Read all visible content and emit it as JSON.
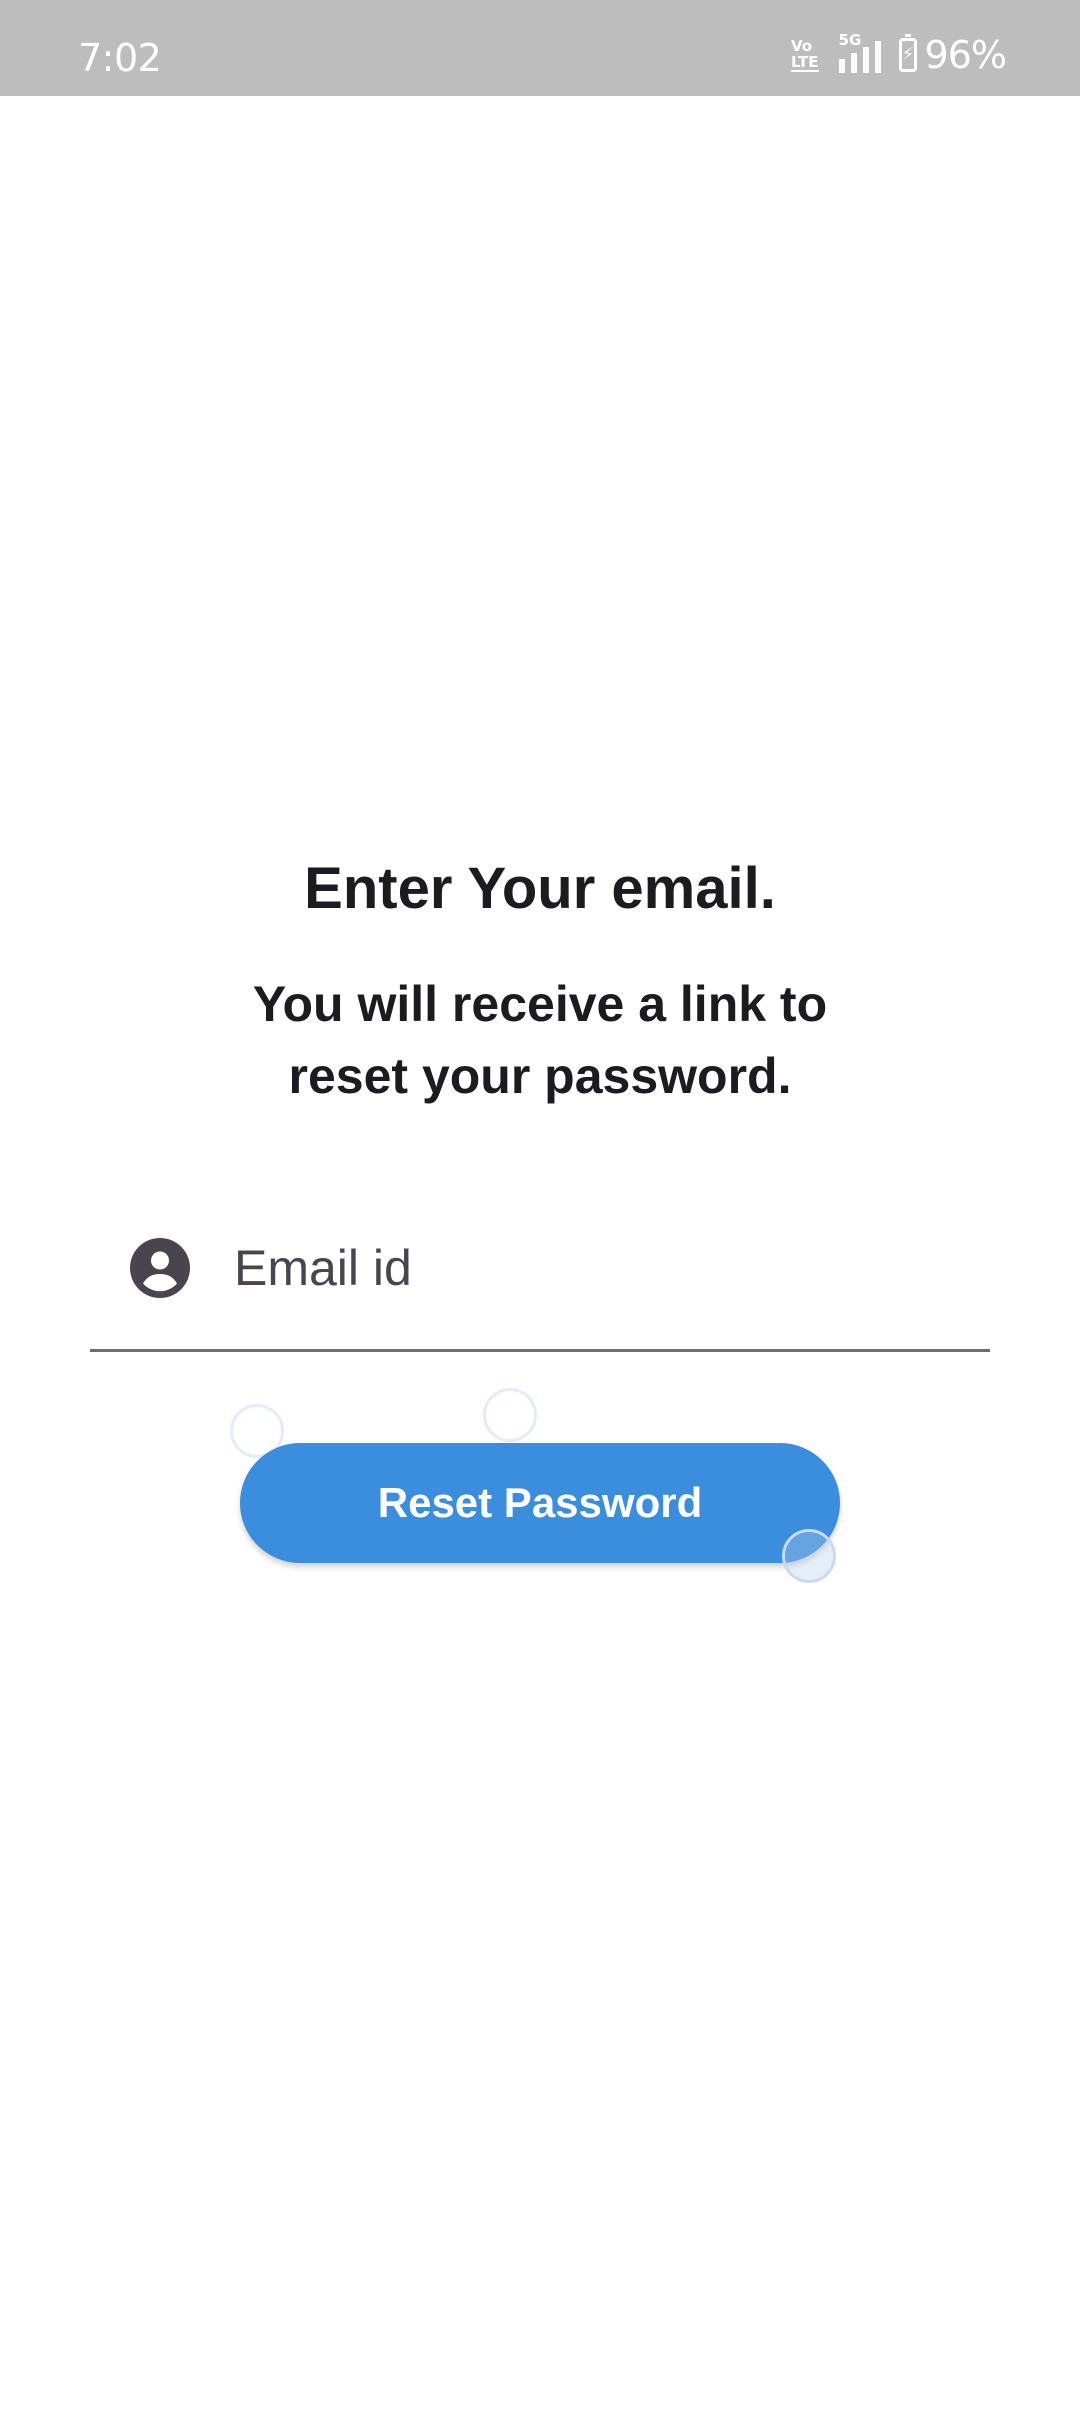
{
  "status_bar": {
    "time": "7:02",
    "volte_line1": "Vo",
    "volte_line2": "LTE",
    "network": "5G",
    "battery_percent": "96%",
    "battery_level": 0.96,
    "background_color": "#bdbdbd"
  },
  "content": {
    "heading": "Enter Your email.",
    "subheading_line1": "You will receive a link to",
    "subheading_line2": "reset your password."
  },
  "email_field": {
    "icon": "person-icon",
    "placeholder": "Email id",
    "value": ""
  },
  "reset_button": {
    "label": "Reset Password",
    "color": "#3b8ddd"
  }
}
